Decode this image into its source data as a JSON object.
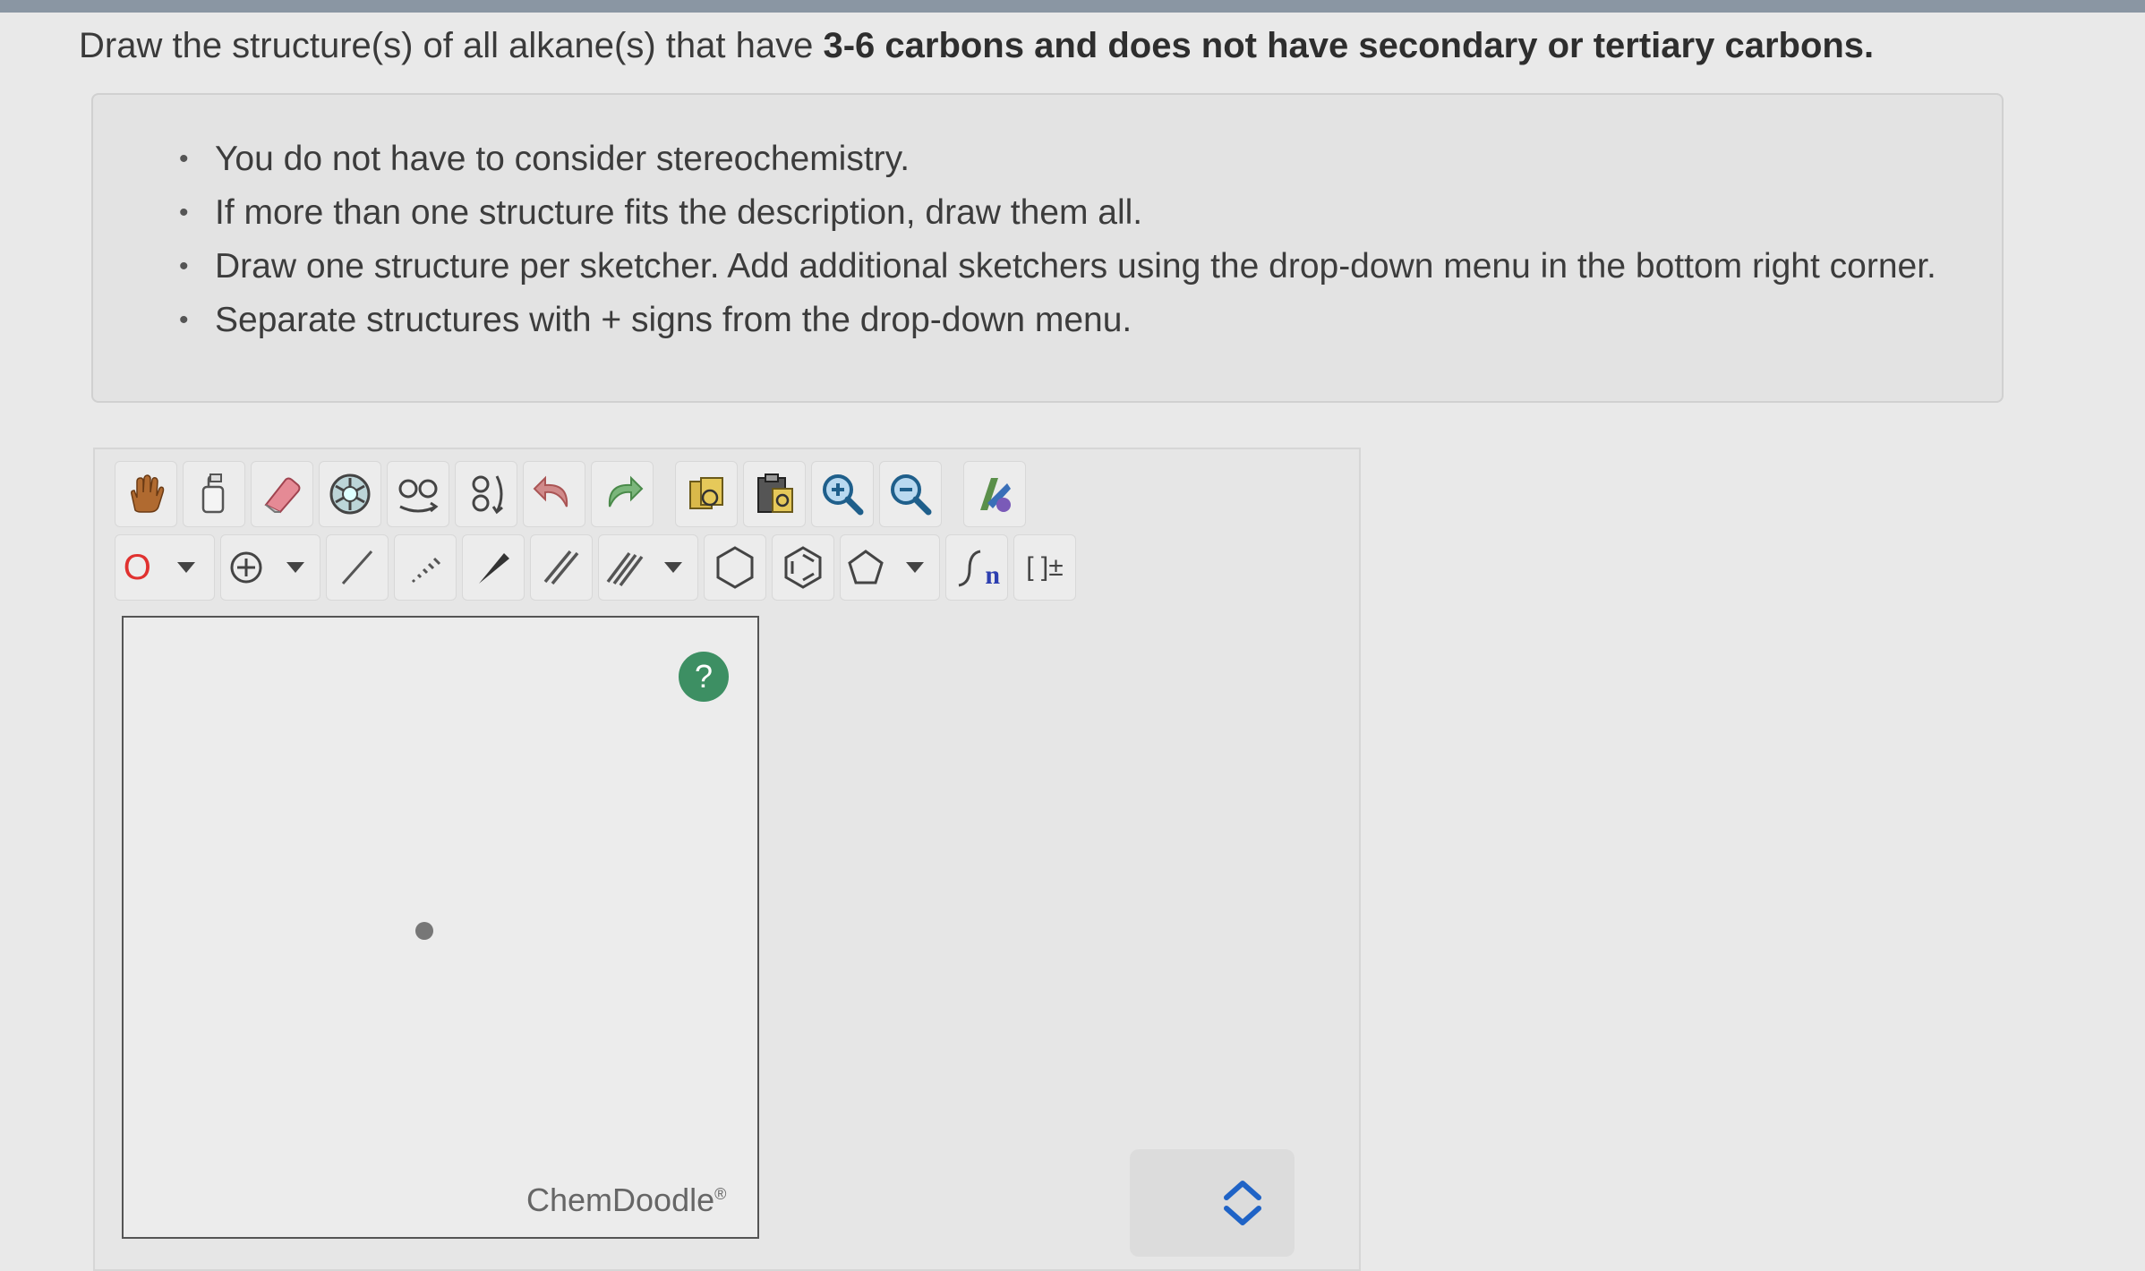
{
  "question": {
    "prefix": "Draw the structure(s) of all alkane(s) that have ",
    "bold": "3-6 carbons and does not have secondary or tertiary carbons."
  },
  "instructions": [
    "You do not have to consider stereochemistry.",
    "If more than one structure fits the description, draw them all.",
    "Draw one structure per sketcher. Add additional sketchers using the drop-down menu in the bottom right corner.",
    "Separate structures with + signs from the drop-down menu."
  ],
  "toolbar": {
    "row1_icons": [
      "hand-icon",
      "lasso-icon",
      "eraser-icon",
      "clear-icon",
      "flip-horizontal-icon",
      "flip-vertical-icon",
      "undo-icon",
      "redo-icon",
      "copy-icon",
      "paste-icon",
      "zoom-in-icon",
      "zoom-out-icon",
      "clean-icon"
    ],
    "row2_icons": [
      "atom-label-icon",
      "charge-icon",
      "single-bond-icon",
      "hash-bond-icon",
      "wedge-bond-icon",
      "double-bond-icon",
      "triple-bond-icon",
      "cyclohexane-icon",
      "benzene-icon",
      "cyclopentane-icon",
      "chain-icon",
      "bracket-icon"
    ],
    "atom_label": "O",
    "chain_label": "n",
    "bracket_label": "[ ]±"
  },
  "canvas": {
    "help_label": "?",
    "brand": "ChemDoodle",
    "brand_mark": "®"
  },
  "colors": {
    "help_button": "#3d8f63",
    "atom_label": "#e0312f",
    "chain_n": "#2d3fb0"
  }
}
